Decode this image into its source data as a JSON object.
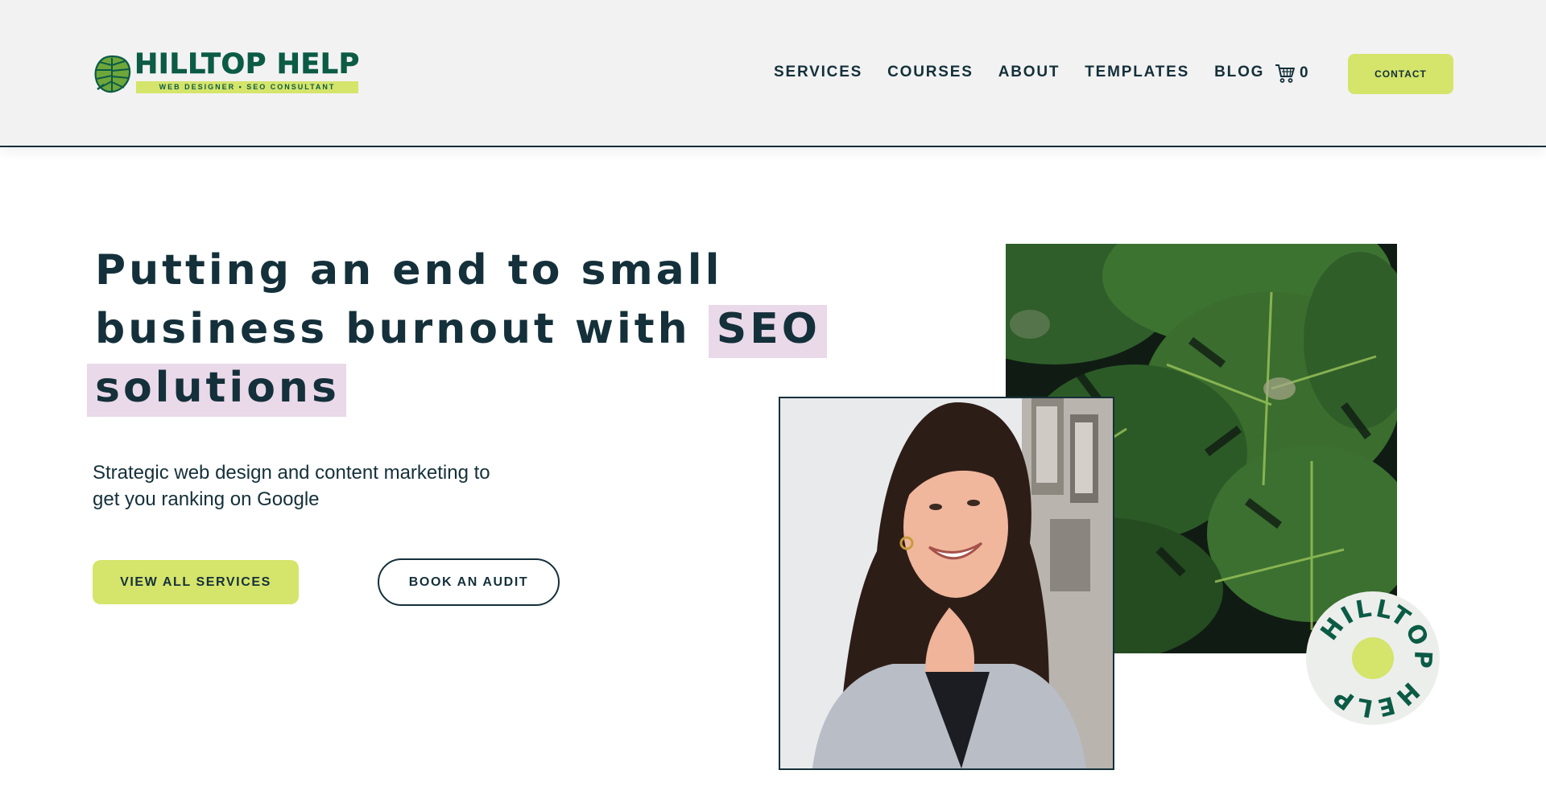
{
  "header": {
    "logo": {
      "title": "HILLTOP HELP",
      "subtitle": "WEB DESIGNER • SEO CONSULTANT",
      "icon": "monstera-leaf-icon"
    },
    "nav": [
      {
        "label": "SERVICES"
      },
      {
        "label": "COURSES"
      },
      {
        "label": "ABOUT"
      },
      {
        "label": "TEMPLATES"
      },
      {
        "label": "BLOG"
      }
    ],
    "cart": {
      "icon": "cart-icon",
      "count": "0"
    },
    "contact_label": "CONTACT"
  },
  "hero": {
    "headline": {
      "line1": "Putting an end to small",
      "line2_plain": "business burnout with ",
      "line2_highlight": "SEO",
      "line3_highlight": "solutions"
    },
    "subheading": {
      "line1": "Strategic web design and content marketing to",
      "line2": "get you ranking on Google"
    },
    "primary_button": "VIEW ALL SERVICES",
    "secondary_button": "BOOK AN AUDIT"
  },
  "badge": {
    "text": "HILLTOP HELP"
  },
  "colors": {
    "accent_lime": "#d5e46a",
    "brand_green": "#0b5b45",
    "text_dark": "#14303a",
    "highlight_pink": "#ead9e9",
    "header_bg": "#f2f2f2"
  }
}
